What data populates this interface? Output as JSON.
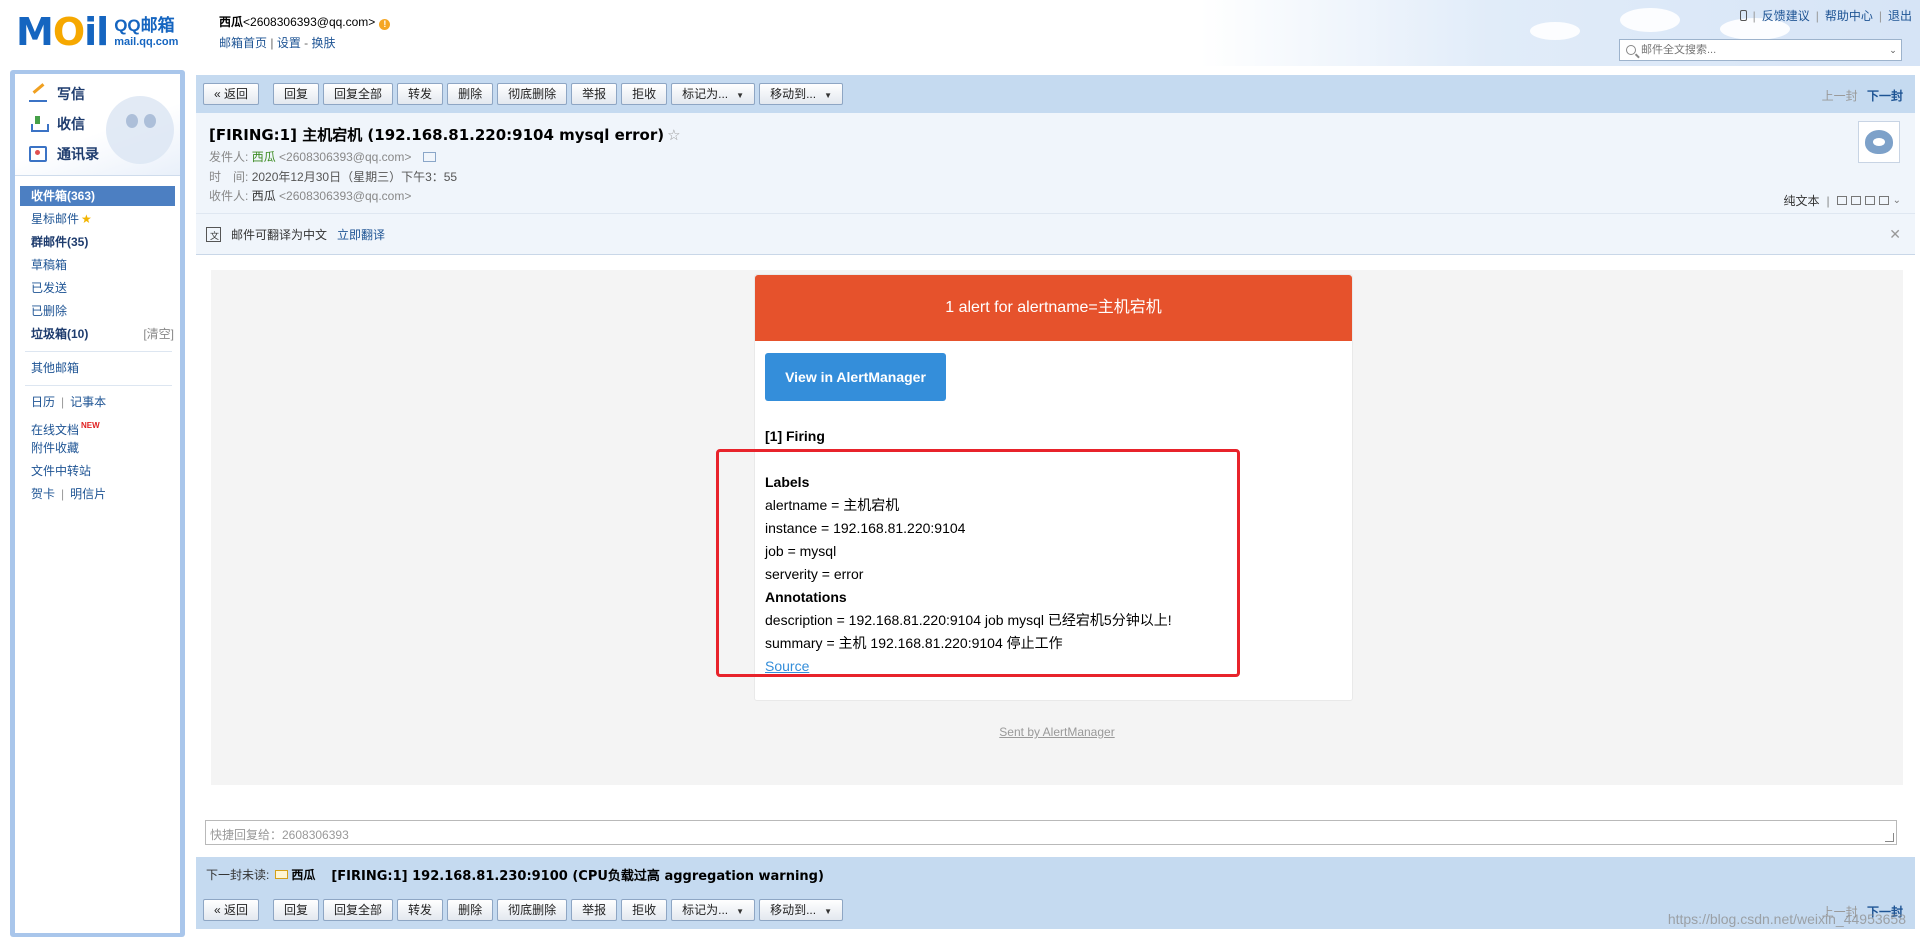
{
  "header": {
    "logo_mail": "MAIL",
    "logo_cn": "QQ邮箱",
    "logo_domain": "mail.qq.com",
    "user_name": "西瓜",
    "user_email": "<2608306393@qq.com>",
    "links": [
      "邮箱首页",
      "设置",
      "换肤"
    ],
    "top_links": [
      "反馈建议",
      "帮助中心",
      "退出"
    ],
    "search_placeholder": "邮件全文搜索..."
  },
  "sidebar": {
    "quick": [
      {
        "label": "写信",
        "icon": "write-icon"
      },
      {
        "label": "收信",
        "icon": "inbox-icon"
      },
      {
        "label": "通讯录",
        "icon": "contacts-icon"
      }
    ],
    "folders": {
      "inbox": "收件箱(363)",
      "starred": "星标邮件",
      "group": "群邮件(35)",
      "drafts": "草稿箱",
      "sent": "已发送",
      "deleted": "已删除",
      "spam": "垃圾箱(10)",
      "spam_clear": "[清空]",
      "other": "其他邮箱",
      "calendar": "日历",
      "notebook": "记事本",
      "docs": "在线文档",
      "docs_new": "NEW",
      "attachments": "附件收藏",
      "transfer": "文件中转站",
      "cards": "贺卡",
      "postcards": "明信片"
    }
  },
  "toolbar": {
    "back": "« 返回",
    "reply": "回复",
    "reply_all": "回复全部",
    "forward": "转发",
    "delete": "删除",
    "delete_perm": "彻底删除",
    "report": "举报",
    "reject": "拒收",
    "mark_as": "标记为...",
    "move_to": "移动到...",
    "prev": "上一封",
    "next": "下一封"
  },
  "mail": {
    "subject": "[FIRING:1] 主机宕机 (192.168.81.220:9104 mysql error)",
    "from_label": "发件人:",
    "from_name": "西瓜",
    "from_email": "<2608306393@qq.com>",
    "time_label": "时　间:",
    "time_value": "2020年12月30日（星期三）下午3：55",
    "to_label": "收件人:",
    "to_name": "西瓜",
    "to_email": "<2608306393@qq.com>",
    "plain_text": "纯文本",
    "translate_msg": "邮件可翻译为中文",
    "translate_link": "立即翻译"
  },
  "alert": {
    "header": "1 alert for alertname=主机宕机",
    "button": "View in AlertManager",
    "firing": "[1] Firing",
    "labels_title": "Labels",
    "labels": [
      "alertname = 主机宕机",
      "instance = 192.168.81.220:9104",
      "job = mysql",
      "serverity = error"
    ],
    "annotations_title": "Annotations",
    "annotations": [
      "description = 192.168.81.220:9104 job mysql 已经宕机5分钟以上!",
      "summary = 主机 192.168.81.220:9104 停止工作"
    ],
    "source": "Source",
    "sent_by": "Sent by AlertManager"
  },
  "footer": {
    "quick_reply_placeholder": "快捷回复给：2608306393",
    "next_unread_label": "下一封未读:",
    "next_unread_from": "西瓜",
    "next_unread_subject": "[FIRING:1] 192.168.81.230:9100 (CPU负载过高 aggregation warning)"
  },
  "watermark": "https://blog.csdn.net/weixin_44953658",
  "colors": {
    "alert_header": "#e6522c",
    "alert_button": "#348eda",
    "highlight_box": "#e8232b",
    "toolbar_bg": "#c5daf0"
  }
}
